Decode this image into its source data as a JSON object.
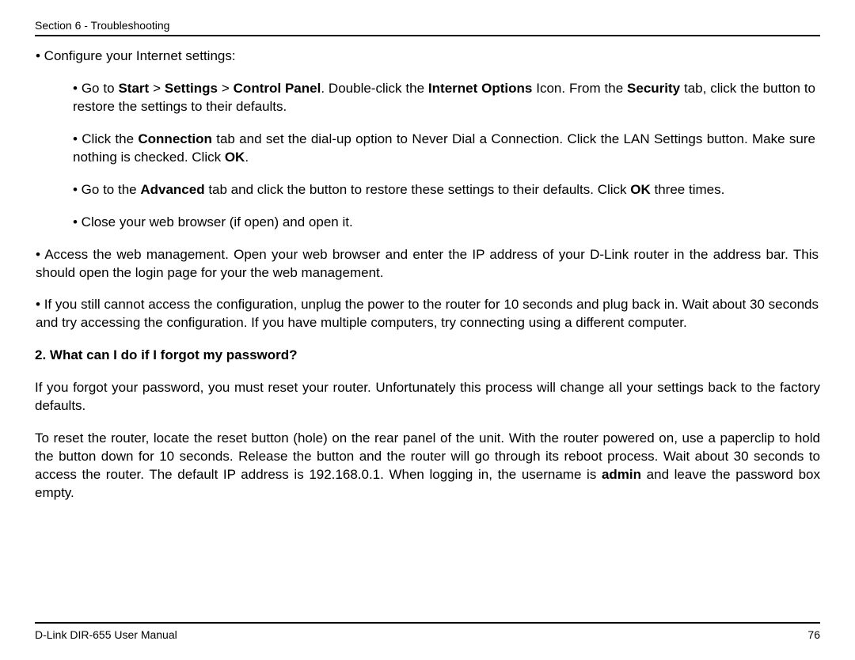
{
  "header": {
    "section": "Section 6 - Troubleshooting"
  },
  "content": {
    "line_configure": "• Configure your Internet settings:",
    "sub": {
      "goto_pre": "• Go to ",
      "goto_b1": "Start",
      "goto_sep1": " > ",
      "goto_b2": "Settings",
      "goto_sep2": " > ",
      "goto_b3": "Control Panel",
      "goto_mid": ". Double-click the ",
      "goto_b4": "Internet Options",
      "goto_mid2": " Icon. From the ",
      "goto_b5": "Security",
      "goto_post": " tab, click the button to restore the settings to their defaults.",
      "conn_pre": "• Click the ",
      "conn_b1": "Connection",
      "conn_mid": " tab and set the dial-up option to Never Dial a Connection. Click the LAN Settings button. Make sure nothing is checked. Click ",
      "conn_b2": "OK",
      "conn_post": ".",
      "adv_pre": "• Go to the ",
      "adv_b1": "Advanced",
      "adv_mid": " tab and click the button to restore these settings to their defaults. Click ",
      "adv_b2": "OK",
      "adv_post": " three times.",
      "close": "• Close your web browser (if open) and open it."
    },
    "access": "• Access the web management. Open your web browser and enter the IP address of your D-Link router in the address bar. This should open the login page for your the web management.",
    "still": "• If you still cannot access the configuration, unplug the power to the router for 10 seconds and plug back in. Wait about 30 seconds and try accessing the configuration. If you have multiple computers, try connecting using a different computer.",
    "q2": "2. What can I do if I forgot my password?",
    "ans1": "If you forgot your password, you must reset your router. Unfortunately this process will change all your settings back to the factory defaults.",
    "ans2_pre": "To reset the router, locate the reset button (hole) on the rear panel of the unit. With the router powered on, use a paperclip to hold the button down for 10 seconds. Release the button and the router will go through its reboot process. Wait about 30 seconds to access the router. The default IP address is 192.168.0.1. When logging in, the username is ",
    "ans2_b": "admin",
    "ans2_post": " and leave the password box empty."
  },
  "footer": {
    "manual": "D-Link DIR-655 User Manual",
    "page": "76"
  }
}
